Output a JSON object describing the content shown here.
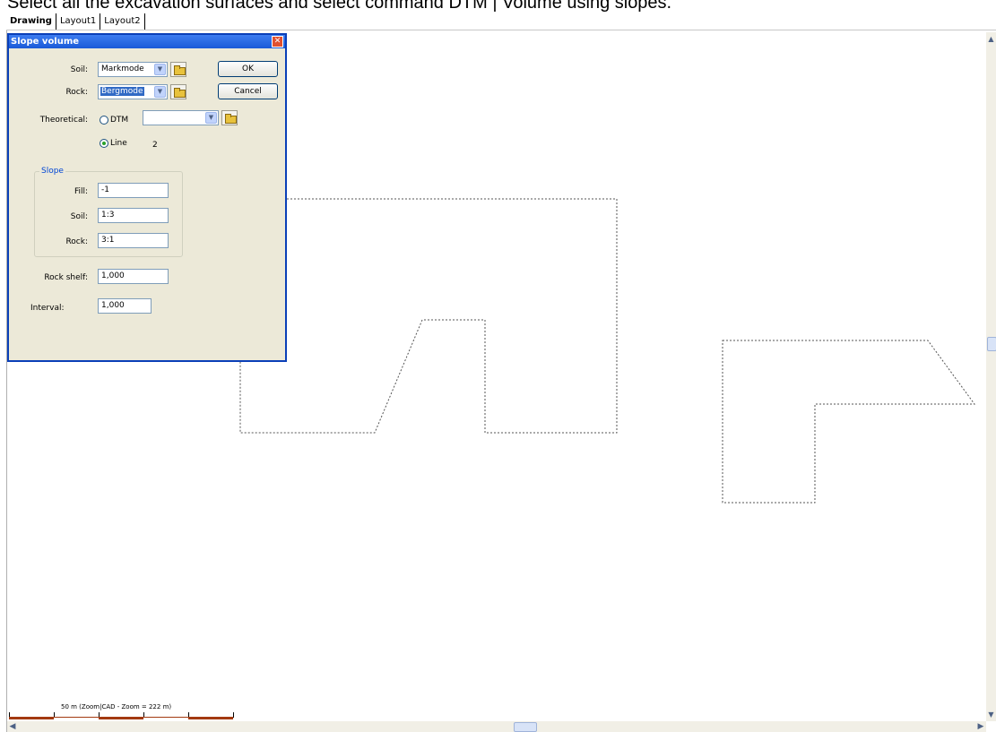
{
  "caption": "Select all the excavation surfaces and select command DTM | Volume using slopes.",
  "tabs": [
    {
      "label": "Drawing"
    },
    {
      "label": "Layout1"
    },
    {
      "label": "Layout2"
    }
  ],
  "dialog": {
    "title": "Slope volume",
    "soil_label": "Soil:",
    "soil_value": "Markmode",
    "rock_label": "Rock:",
    "rock_value": "Bergmode",
    "theoretical_label": "Theoretical:",
    "dtm_option": "DTM",
    "dtm_value": "",
    "line_option": "Line",
    "line_value": "2",
    "selected_option": "Line",
    "ok_label": "OK",
    "cancel_label": "Cancel",
    "slope_group": "Slope",
    "fill_label": "Fill:",
    "fill_value": "-1",
    "slope_soil_label": "Soil:",
    "slope_soil_value": "1:3",
    "slope_rock_label": "Rock:",
    "slope_rock_value": "3:1",
    "rock_shelf_label": "Rock shelf:",
    "rock_shelf_value": "1,000",
    "interval_label": "Interval:",
    "interval_value": "1,000"
  },
  "scale_bar": {
    "text": "50 m  (Zoom|CAD - Zoom = 222 m)"
  },
  "colors": {
    "title_bar": "#1a5bd8",
    "dialog_bg": "#ece9d8",
    "scale_bar_red": "#a33a10",
    "outline": "#555555"
  }
}
